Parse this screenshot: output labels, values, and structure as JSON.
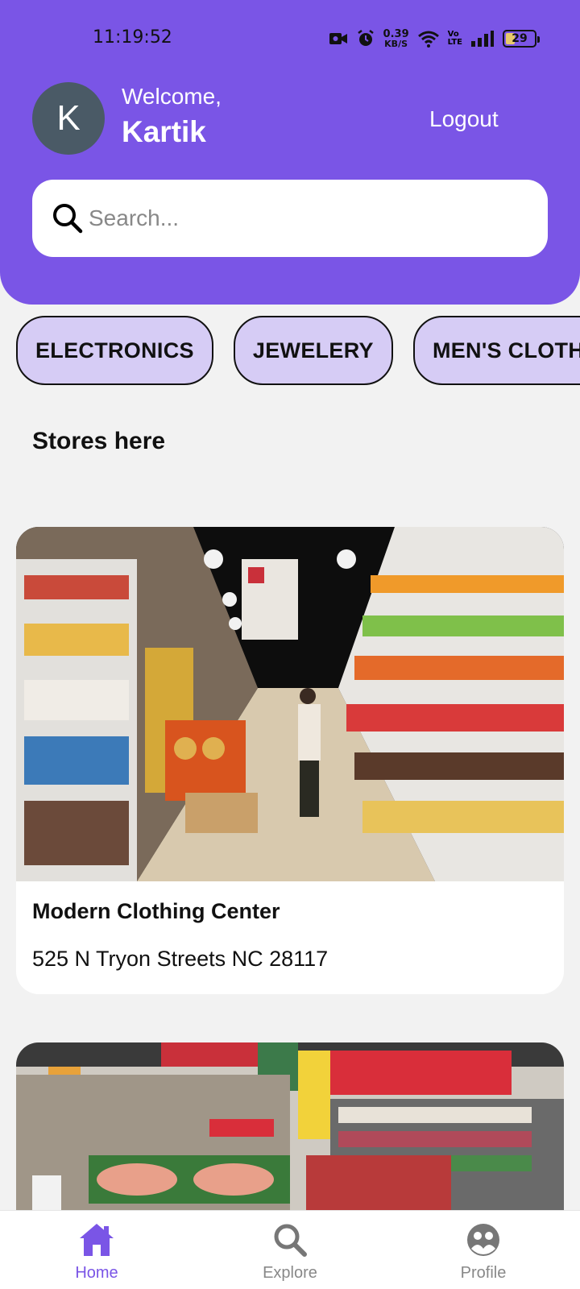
{
  "status_bar": {
    "time": "11:19:52",
    "net_speed_value": "0.39",
    "net_speed_unit": "KB/S",
    "volte_top": "Vo",
    "volte_bottom": "LTE",
    "battery": "29"
  },
  "header": {
    "avatar_initial": "K",
    "welcome": "Welcome,",
    "username": "Kartik",
    "logout_label": "Logout"
  },
  "search": {
    "placeholder": "Search..."
  },
  "categories": [
    {
      "label": "ELECTRONICS"
    },
    {
      "label": "JEWELERY"
    },
    {
      "label": "MEN'S CLOTHING"
    }
  ],
  "stores_section": {
    "title": "Stores here"
  },
  "stores": [
    {
      "name": "Modern Clothing Center",
      "address": "525 N Tryon Streets NC 28117"
    },
    {
      "name": "",
      "address": ""
    }
  ],
  "bottom_nav": [
    {
      "label": "Home",
      "icon": "home-icon",
      "active": true
    },
    {
      "label": "Explore",
      "icon": "search-icon",
      "active": false
    },
    {
      "label": "Profile",
      "icon": "profile-icon",
      "active": false
    }
  ],
  "colors": {
    "primary": "#7a55e6",
    "chip_bg": "#d6ccf5",
    "active_nav": "#7a55e6",
    "inactive_nav": "#888888"
  }
}
